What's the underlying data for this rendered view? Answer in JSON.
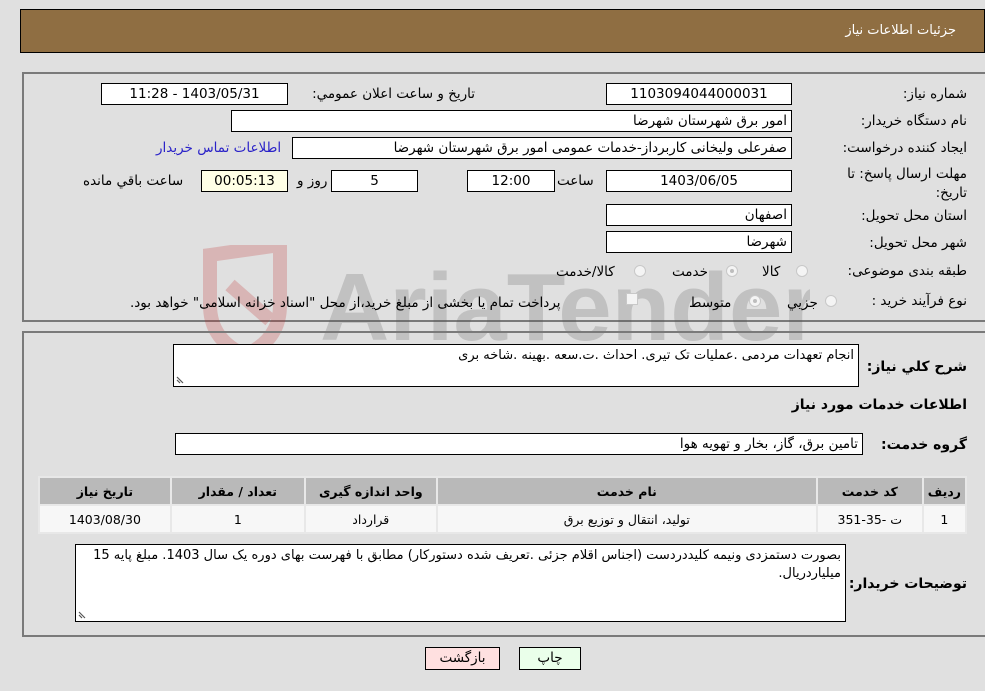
{
  "header": {
    "title": "جزئیات اطلاعات نیاز"
  },
  "form": {
    "need_number": {
      "label": "شماره نیاز:",
      "value": "1103094044000031"
    },
    "announce_datetime": {
      "label": "تاریخ و ساعت اعلان عمومي:",
      "value": "1403/05/31 - 11:28"
    },
    "buyer_org": {
      "label": "نام دستگاه خريدار:",
      "value": "امور برق شهرستان شهرضا"
    },
    "requester": {
      "label": "ایجاد کننده درخواست:",
      "value": "صفرعلی ولیخانی کاربرداز-خدمات عمومی امور برق شهرستان شهرضا"
    },
    "buyer_contact_link": "اطلاعات تماس خريدار",
    "deadline": {
      "label": "مهلت ارسال پاسخ: تا تاریخ:",
      "date": "1403/06/05",
      "time_label": "ساعت",
      "time": "12:00",
      "days": "5",
      "days_label": "روز و",
      "remaining": "00:05:13",
      "remaining_label": "ساعت باقي مانده"
    },
    "province": {
      "label": "استان محل تحویل:",
      "value": "اصفهان"
    },
    "city": {
      "label": "شهر محل تحویل:",
      "value": "شهرضا"
    },
    "category": {
      "label": "طبقه بندی موضوعی:",
      "options": [
        "کالا",
        "خدمت",
        "کالا/خدمت"
      ],
      "selected": "خدمت"
    },
    "purchase_type": {
      "label": "نوع فرآیند خرید :",
      "options": [
        "جزيي",
        "متوسط"
      ],
      "selected": "متوسط",
      "treasury_checkbox_label": "پرداخت تمام یا بخشی از مبلغ خرید،از محل \"اسناد خزانه اسلامی\" خواهد بود.",
      "treasury_checked": false
    }
  },
  "summary": {
    "label": "شرح كلي نياز:",
    "value": "انجام تعهدات مردمی .عملیات تک تیری. احداث .ت.سعه .بهینه .شاخه بری"
  },
  "services_section": {
    "title": "اطلاعات خدمات مورد نیاز",
    "group_label": "گروه خدمت:",
    "group_value": "تامین برق، گاز، بخار و تهویه هوا",
    "table": {
      "headers": [
        "ردیف",
        "کد خدمت",
        "نام خدمت",
        "واحد اندازه گیری",
        "تعداد / مقدار",
        "تاریخ نیاز"
      ],
      "rows": [
        [
          "1",
          "ت -35-351",
          "تولید، انتقال و توزیع برق",
          "قرارداد",
          "1",
          "1403/08/30"
        ]
      ]
    }
  },
  "buyer_notes": {
    "label": "توضیحات خریدار:",
    "value": "بصورت دستمزدی ونیمه کلیددردست (اجناس اقلام جزئی .تعریف شده دستورکار) مطابق با فهرست بهای دوره یک سال 1403. مبلغ پایه 15 میلیاردریال."
  },
  "buttons": {
    "print": "چاپ",
    "back": "بازگشت"
  },
  "watermark": {
    "text": "AriaTender.neT"
  },
  "colors": {
    "header_bg": "#8f6e42",
    "link": "#2a22c8",
    "back_bg": "#ffe0e0",
    "print_bg": "#eaffea",
    "remaining_bg": "#ffffe6"
  }
}
